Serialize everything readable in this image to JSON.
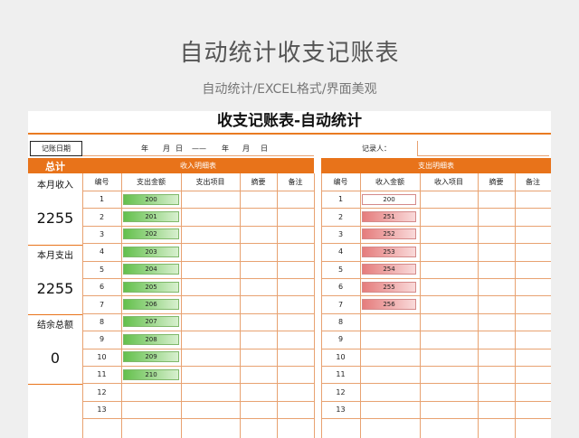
{
  "page": {
    "title": "自动统计收支记账表",
    "subtitle": "自动统计/EXCEL格式/界面美观"
  },
  "sheet": {
    "title": "收支记账表-自动统计",
    "date_label": "记账日期",
    "date_range": [
      "年",
      "月",
      "日",
      "——",
      "年",
      "月",
      "日"
    ],
    "recorder_label": "记录人："
  },
  "summary": {
    "header": "总计",
    "income_label": "本月收入",
    "income_value": "2255",
    "expense_label": "本月支出",
    "expense_value": "2255",
    "balance_label": "结余总额",
    "balance_value": "0"
  },
  "income_table": {
    "title": "收入明细表",
    "columns": [
      "编号",
      "支出金额",
      "支出项目",
      "摘要",
      "备注"
    ],
    "rows": [
      {
        "no": "1",
        "amount": "200"
      },
      {
        "no": "2",
        "amount": "201"
      },
      {
        "no": "3",
        "amount": "202"
      },
      {
        "no": "4",
        "amount": "203"
      },
      {
        "no": "5",
        "amount": "204"
      },
      {
        "no": "6",
        "amount": "205"
      },
      {
        "no": "7",
        "amount": "206"
      },
      {
        "no": "8",
        "amount": "207"
      },
      {
        "no": "9",
        "amount": "208"
      },
      {
        "no": "10",
        "amount": "209"
      },
      {
        "no": "11",
        "amount": "210"
      },
      {
        "no": "12",
        "amount": ""
      },
      {
        "no": "13",
        "amount": ""
      }
    ],
    "bar_color": "#63c04c"
  },
  "expense_table": {
    "title": "支出明细表",
    "columns": [
      "编号",
      "收入金额",
      "收入项目",
      "摘要",
      "备注"
    ],
    "rows": [
      {
        "no": "1",
        "amount": "200"
      },
      {
        "no": "2",
        "amount": "251"
      },
      {
        "no": "3",
        "amount": "252"
      },
      {
        "no": "4",
        "amount": "253"
      },
      {
        "no": "5",
        "amount": "254"
      },
      {
        "no": "6",
        "amount": "255"
      },
      {
        "no": "7",
        "amount": "256"
      },
      {
        "no": "8",
        "amount": ""
      },
      {
        "no": "9",
        "amount": ""
      },
      {
        "no": "10",
        "amount": ""
      },
      {
        "no": "11",
        "amount": ""
      },
      {
        "no": "12",
        "amount": ""
      },
      {
        "no": "13",
        "amount": ""
      }
    ],
    "bar_color": "#e57c7c"
  },
  "colors": {
    "accent": "#e8731a",
    "grid": "#e8a271"
  }
}
